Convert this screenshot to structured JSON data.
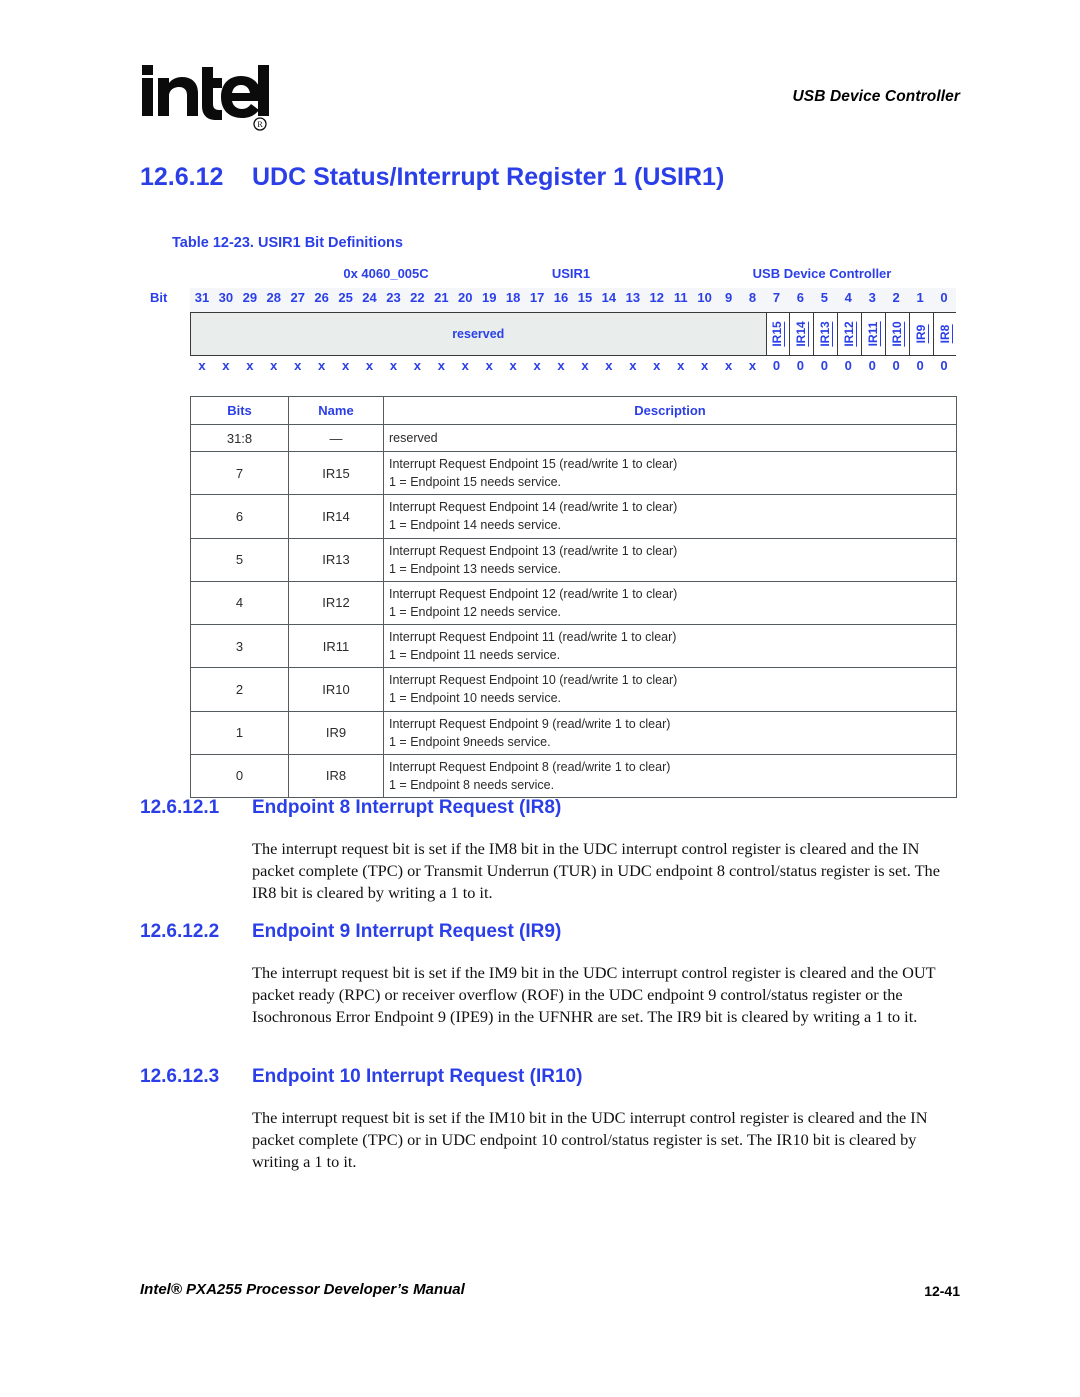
{
  "header": {
    "logo_text": "intel",
    "logo_mark": "registered-trademark",
    "running_head": "USB Device Controller"
  },
  "section": {
    "number": "12.6.12",
    "title": "UDC Status/Interrupt Register 1 (USIR1)"
  },
  "table_caption": "Table 12-23. USIR1 Bit Definitions",
  "register": {
    "address": "0x 4060_005C",
    "name": "USIR1",
    "owner": "USB Device Controller",
    "bit_axis_label": "Bit",
    "bit_numbers": [
      "31",
      "30",
      "29",
      "28",
      "27",
      "26",
      "25",
      "24",
      "23",
      "22",
      "21",
      "20",
      "19",
      "18",
      "17",
      "16",
      "15",
      "14",
      "13",
      "12",
      "11",
      "10",
      "9",
      "8",
      "7",
      "6",
      "5",
      "4",
      "3",
      "2",
      "1",
      "0"
    ],
    "reserved_label": "reserved",
    "fields": [
      "IR15",
      "IR14",
      "IR13",
      "IR12",
      "IR11",
      "IR10",
      "IR9",
      "IR8"
    ],
    "reset_values": [
      "x",
      "x",
      "x",
      "x",
      "x",
      "x",
      "x",
      "x",
      "x",
      "x",
      "x",
      "x",
      "x",
      "x",
      "x",
      "x",
      "x",
      "x",
      "x",
      "x",
      "x",
      "x",
      "x",
      "x",
      "0",
      "0",
      "0",
      "0",
      "0",
      "0",
      "0",
      "0"
    ]
  },
  "definitions": {
    "columns": [
      "Bits",
      "Name",
      "Description"
    ],
    "rows": [
      {
        "bits": "31:8",
        "name": "—",
        "desc1": "reserved",
        "desc2": ""
      },
      {
        "bits": "7",
        "name": "IR15",
        "desc1": "Interrupt Request Endpoint 15 (read/write 1 to clear)",
        "desc2": "1 =   Endpoint 15 needs service."
      },
      {
        "bits": "6",
        "name": "IR14",
        "desc1": "Interrupt Request Endpoint 14 (read/write 1 to clear)",
        "desc2": "1 =   Endpoint 14 needs service."
      },
      {
        "bits": "5",
        "name": "IR13",
        "desc1": "Interrupt Request Endpoint 13 (read/write 1 to clear)",
        "desc2": "1 =   Endpoint 13 needs service."
      },
      {
        "bits": "4",
        "name": "IR12",
        "desc1": "Interrupt Request Endpoint 12 (read/write 1 to clear)",
        "desc2": "1 =   Endpoint 12 needs service."
      },
      {
        "bits": "3",
        "name": "IR11",
        "desc1": "Interrupt Request Endpoint 11 (read/write 1 to clear)",
        "desc2": "1 =   Endpoint 11 needs service."
      },
      {
        "bits": "2",
        "name": "IR10",
        "desc1": "Interrupt Request Endpoint 10 (read/write 1 to clear)",
        "desc2": "1 =   Endpoint 10 needs service."
      },
      {
        "bits": "1",
        "name": "IR9",
        "desc1": "Interrupt Request Endpoint 9 (read/write 1 to clear)",
        "desc2": "1 =   Endpoint 9needs service."
      },
      {
        "bits": "0",
        "name": "IR8",
        "desc1": "Interrupt Request Endpoint 8 (read/write 1 to clear)",
        "desc2": "1 =   Endpoint 8 needs service."
      }
    ]
  },
  "subsections": [
    {
      "number": "12.6.12.1",
      "title": "Endpoint 8 Interrupt Request (IR8)",
      "body": "The interrupt request bit is set if the IM8 bit in the UDC interrupt control register is cleared and the IN packet complete (TPC) or Transmit Underrun (TUR) in UDC endpoint 8 control/status register is set. The IR8 bit is cleared by writing a 1 to it."
    },
    {
      "number": "12.6.12.2",
      "title": "Endpoint 9 Interrupt Request (IR9)",
      "body": "The interrupt request bit is set if the IM9 bit in the UDC interrupt control register is cleared and the OUT packet ready (RPC) or receiver overflow (ROF) in the UDC endpoint 9 control/status register or the Isochronous Error Endpoint 9 (IPE9) in the UFNHR are set. The IR9 bit is cleared by writing a 1 to it."
    },
    {
      "number": "12.6.12.3",
      "title": "Endpoint 10 Interrupt Request (IR10)",
      "body": "The interrupt request bit is set if the IM10 bit in the UDC interrupt control register is cleared and the IN packet complete (TPC) or in UDC endpoint 10 control/status register is set. The IR10 bit is cleared by writing a 1 to it."
    }
  ],
  "footer": {
    "manual_title": "Intel® PXA255 Processor Developer’s Manual",
    "page_number": "12-41"
  },
  "colors": {
    "heading_blue": "#2B3FE8",
    "field_fill": "#E9EEED",
    "bitrow_fill": "#F4F6FA",
    "border_dark": "#3A3A3A",
    "table_border": "#555c60"
  }
}
